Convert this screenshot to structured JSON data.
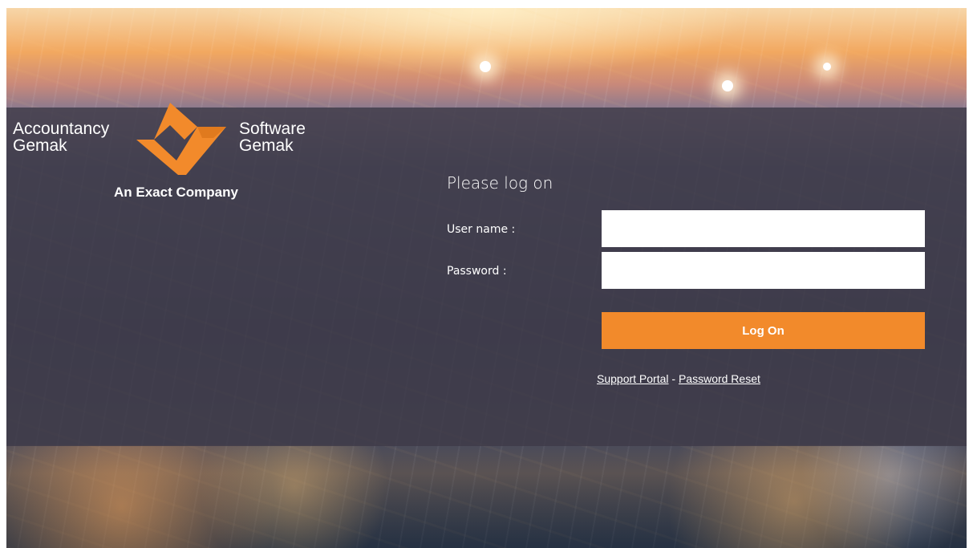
{
  "brand": {
    "left_line1": "Accountancy",
    "left_line2": "Gemak",
    "right_line1": "Software",
    "right_line2": "Gemak",
    "tagline": "An Exact Company",
    "accent_color": "#f28a2b"
  },
  "login": {
    "heading": "Please log on",
    "username_label": "User name :",
    "username_value": "",
    "password_label": "Password :",
    "password_value": "",
    "submit_label": "Log On"
  },
  "links": {
    "support_portal": "Support Portal",
    "separator": " - ",
    "password_reset": "Password Reset"
  }
}
